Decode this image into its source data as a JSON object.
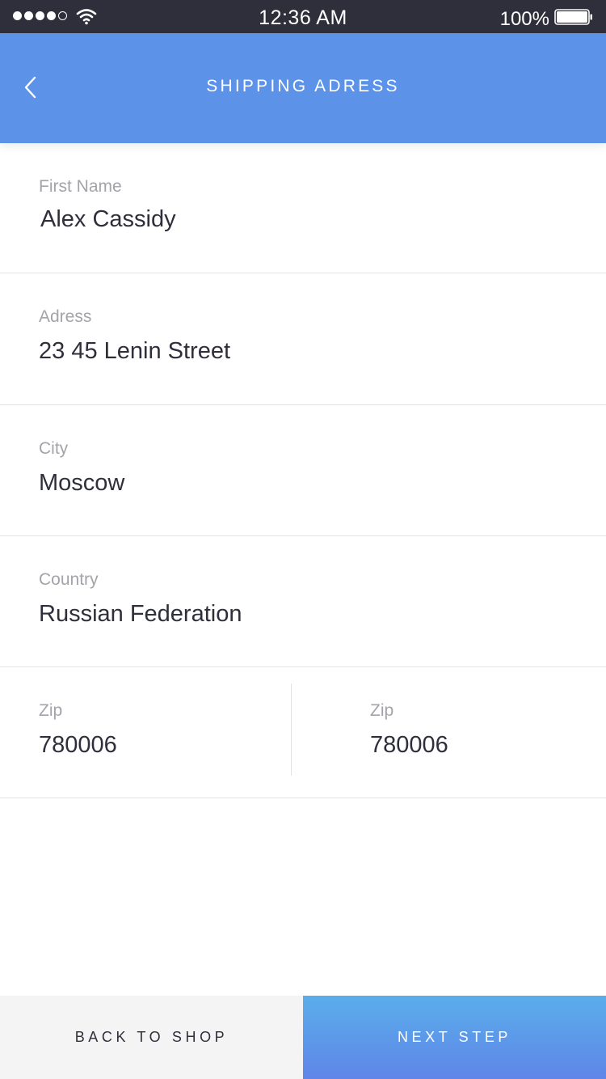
{
  "status_bar": {
    "time": "12:36 AM",
    "battery_percent": "100%",
    "signal_bars_filled": 4,
    "signal_bars_total": 5,
    "icons": [
      "signal-dots-icon",
      "wifi-icon",
      "battery-icon"
    ]
  },
  "header": {
    "title": "SHIPPING ADRESS",
    "back_icon": "chevron-left-icon",
    "background_color": "#5c93e9"
  },
  "form": {
    "first_name": {
      "label": "First Name",
      "value": "Alex Cassidy"
    },
    "address": {
      "label": "Adress",
      "value": "23 45 Lenin Street"
    },
    "city": {
      "label": "City",
      "value": "Moscow"
    },
    "country": {
      "label": "Country",
      "value": "Russian Federation"
    },
    "zip_left": {
      "label": "Zip",
      "value": "780006"
    },
    "zip_right": {
      "label": "Zip",
      "value": "780006"
    }
  },
  "footer": {
    "back_label": "BACK TO SHOP",
    "next_label": "NEXT STEP",
    "next_gradient": [
      "#5aaeea",
      "#5f85e8"
    ]
  }
}
